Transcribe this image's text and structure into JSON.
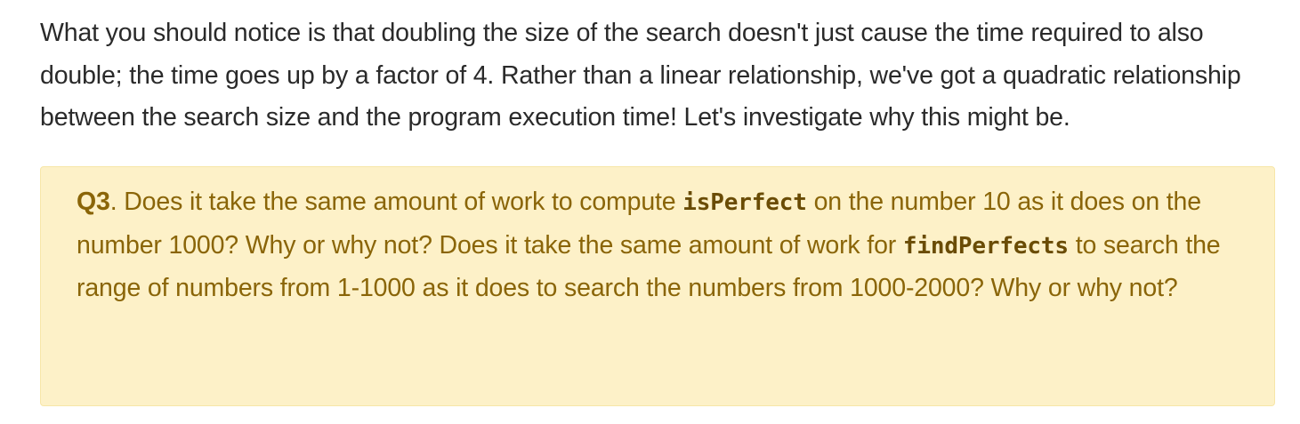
{
  "intro": {
    "text": "What you should notice is that doubling the size of the search doesn't just cause the time required to also double; the time goes up by a factor of 4. Rather than a linear relationship, we've got a quadratic relationship between the search size and the program execution time! Let's investigate why this might be."
  },
  "question": {
    "label": "Q3",
    "part1": ". Does it take the same amount of work to compute ",
    "code1": "isPerfect",
    "part2": " on the number 10 as it does on the number 1000? Why or why not? Does it take the same amount of work for ",
    "code2": "findPerfects",
    "part3": " to search the range of numbers from 1-1000 as it does to search the numbers from 1000-2000? Why or why not?"
  },
  "colors": {
    "body_text": "#2a2a2a",
    "callout_background": "#fdf1c8",
    "callout_text": "#8a6508"
  }
}
